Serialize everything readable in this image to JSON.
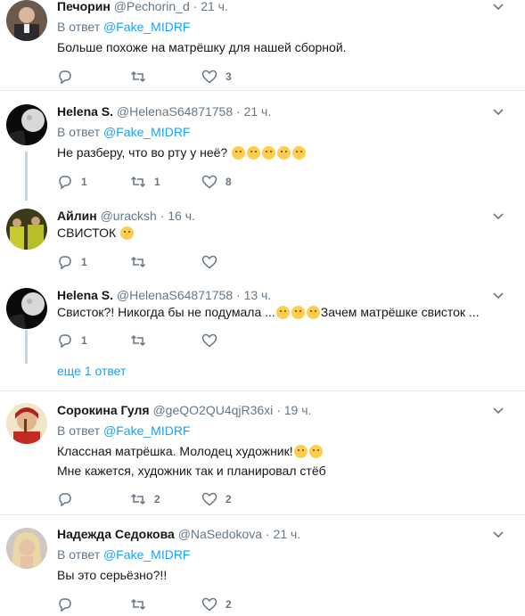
{
  "colors": {
    "accent": "#1da1f2",
    "muted": "#657786",
    "divider": "#e6ecf0",
    "text": "#14171a"
  },
  "tweets": [
    {
      "name": "Печорин",
      "handle": "@Pechorin_d",
      "time": "21 ч.",
      "reply_prefix": "В ответ",
      "reply_to": "@Fake_MIDRF",
      "lines": [
        "Больше похоже на матрёшку для нашей сборной."
      ],
      "reply_count": "",
      "retweet_count": "",
      "like_count": "3"
    },
    {
      "name": "Helena S.",
      "handle": "@HelenaS64871758",
      "time": "21 ч.",
      "reply_prefix": "В ответ",
      "reply_to": "@Fake_MIDRF",
      "lines": [
        "Не разберу, что во рту у неё?"
      ],
      "reply_count": "1",
      "retweet_count": "1",
      "like_count": "8"
    },
    {
      "name": "Айлин",
      "handle": "@uracksh",
      "time": "16 ч.",
      "lines": [
        "СВИСТОК"
      ],
      "reply_count": "1",
      "retweet_count": "",
      "like_count": ""
    },
    {
      "name": "Helena S.",
      "handle": "@HelenaS64871758",
      "time": "13 ч.",
      "lines": [
        "Свисток?! Никогда бы не подумала ...",
        "Зачем матрёшке свисток ..."
      ],
      "reply_count": "1",
      "retweet_count": "",
      "like_count": ""
    },
    {
      "name": "Сорокина Гуля",
      "handle": "@geQO2QU4qjR36xi",
      "time": "19 ч.",
      "reply_prefix": "В ответ",
      "reply_to": "@Fake_MIDRF",
      "lines": [
        "Классная матрёшка. Молодец художник!",
        "Мне кажется, художник так и планировал стёб"
      ],
      "reply_count": "",
      "retweet_count": "2",
      "like_count": "2"
    },
    {
      "name": "Надежда Седокова",
      "handle": "@NaSedokova",
      "time": "21 ч.",
      "reply_prefix": "В ответ",
      "reply_to": "@Fake_MIDRF",
      "lines": [
        "Вы это серьёзно?!!"
      ],
      "reply_count": "",
      "retweet_count": "",
      "like_count": "2"
    }
  ],
  "more_replies": "еще 1 ответ",
  "separator_dot": "·"
}
